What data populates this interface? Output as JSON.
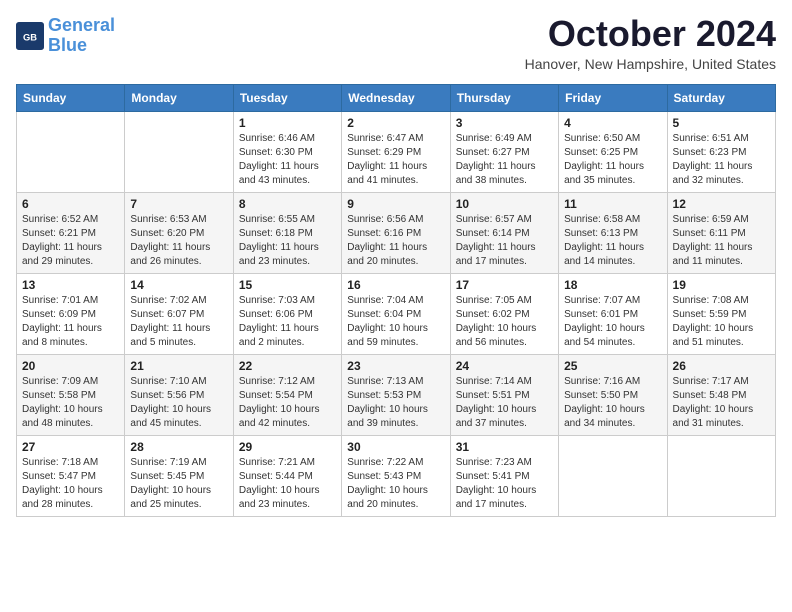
{
  "header": {
    "logo_line1": "General",
    "logo_line2": "Blue",
    "month": "October 2024",
    "location": "Hanover, New Hampshire, United States"
  },
  "weekdays": [
    "Sunday",
    "Monday",
    "Tuesday",
    "Wednesday",
    "Thursday",
    "Friday",
    "Saturday"
  ],
  "weeks": [
    [
      null,
      null,
      {
        "day": "1",
        "sunrise": "6:46 AM",
        "sunset": "6:30 PM",
        "daylight": "11 hours and 43 minutes."
      },
      {
        "day": "2",
        "sunrise": "6:47 AM",
        "sunset": "6:29 PM",
        "daylight": "11 hours and 41 minutes."
      },
      {
        "day": "3",
        "sunrise": "6:49 AM",
        "sunset": "6:27 PM",
        "daylight": "11 hours and 38 minutes."
      },
      {
        "day": "4",
        "sunrise": "6:50 AM",
        "sunset": "6:25 PM",
        "daylight": "11 hours and 35 minutes."
      },
      {
        "day": "5",
        "sunrise": "6:51 AM",
        "sunset": "6:23 PM",
        "daylight": "11 hours and 32 minutes."
      }
    ],
    [
      {
        "day": "6",
        "sunrise": "6:52 AM",
        "sunset": "6:21 PM",
        "daylight": "11 hours and 29 minutes."
      },
      {
        "day": "7",
        "sunrise": "6:53 AM",
        "sunset": "6:20 PM",
        "daylight": "11 hours and 26 minutes."
      },
      {
        "day": "8",
        "sunrise": "6:55 AM",
        "sunset": "6:18 PM",
        "daylight": "11 hours and 23 minutes."
      },
      {
        "day": "9",
        "sunrise": "6:56 AM",
        "sunset": "6:16 PM",
        "daylight": "11 hours and 20 minutes."
      },
      {
        "day": "10",
        "sunrise": "6:57 AM",
        "sunset": "6:14 PM",
        "daylight": "11 hours and 17 minutes."
      },
      {
        "day": "11",
        "sunrise": "6:58 AM",
        "sunset": "6:13 PM",
        "daylight": "11 hours and 14 minutes."
      },
      {
        "day": "12",
        "sunrise": "6:59 AM",
        "sunset": "6:11 PM",
        "daylight": "11 hours and 11 minutes."
      }
    ],
    [
      {
        "day": "13",
        "sunrise": "7:01 AM",
        "sunset": "6:09 PM",
        "daylight": "11 hours and 8 minutes."
      },
      {
        "day": "14",
        "sunrise": "7:02 AM",
        "sunset": "6:07 PM",
        "daylight": "11 hours and 5 minutes."
      },
      {
        "day": "15",
        "sunrise": "7:03 AM",
        "sunset": "6:06 PM",
        "daylight": "11 hours and 2 minutes."
      },
      {
        "day": "16",
        "sunrise": "7:04 AM",
        "sunset": "6:04 PM",
        "daylight": "10 hours and 59 minutes."
      },
      {
        "day": "17",
        "sunrise": "7:05 AM",
        "sunset": "6:02 PM",
        "daylight": "10 hours and 56 minutes."
      },
      {
        "day": "18",
        "sunrise": "7:07 AM",
        "sunset": "6:01 PM",
        "daylight": "10 hours and 54 minutes."
      },
      {
        "day": "19",
        "sunrise": "7:08 AM",
        "sunset": "5:59 PM",
        "daylight": "10 hours and 51 minutes."
      }
    ],
    [
      {
        "day": "20",
        "sunrise": "7:09 AM",
        "sunset": "5:58 PM",
        "daylight": "10 hours and 48 minutes."
      },
      {
        "day": "21",
        "sunrise": "7:10 AM",
        "sunset": "5:56 PM",
        "daylight": "10 hours and 45 minutes."
      },
      {
        "day": "22",
        "sunrise": "7:12 AM",
        "sunset": "5:54 PM",
        "daylight": "10 hours and 42 minutes."
      },
      {
        "day": "23",
        "sunrise": "7:13 AM",
        "sunset": "5:53 PM",
        "daylight": "10 hours and 39 minutes."
      },
      {
        "day": "24",
        "sunrise": "7:14 AM",
        "sunset": "5:51 PM",
        "daylight": "10 hours and 37 minutes."
      },
      {
        "day": "25",
        "sunrise": "7:16 AM",
        "sunset": "5:50 PM",
        "daylight": "10 hours and 34 minutes."
      },
      {
        "day": "26",
        "sunrise": "7:17 AM",
        "sunset": "5:48 PM",
        "daylight": "10 hours and 31 minutes."
      }
    ],
    [
      {
        "day": "27",
        "sunrise": "7:18 AM",
        "sunset": "5:47 PM",
        "daylight": "10 hours and 28 minutes."
      },
      {
        "day": "28",
        "sunrise": "7:19 AM",
        "sunset": "5:45 PM",
        "daylight": "10 hours and 25 minutes."
      },
      {
        "day": "29",
        "sunrise": "7:21 AM",
        "sunset": "5:44 PM",
        "daylight": "10 hours and 23 minutes."
      },
      {
        "day": "30",
        "sunrise": "7:22 AM",
        "sunset": "5:43 PM",
        "daylight": "10 hours and 20 minutes."
      },
      {
        "day": "31",
        "sunrise": "7:23 AM",
        "sunset": "5:41 PM",
        "daylight": "10 hours and 17 minutes."
      },
      null,
      null
    ]
  ]
}
